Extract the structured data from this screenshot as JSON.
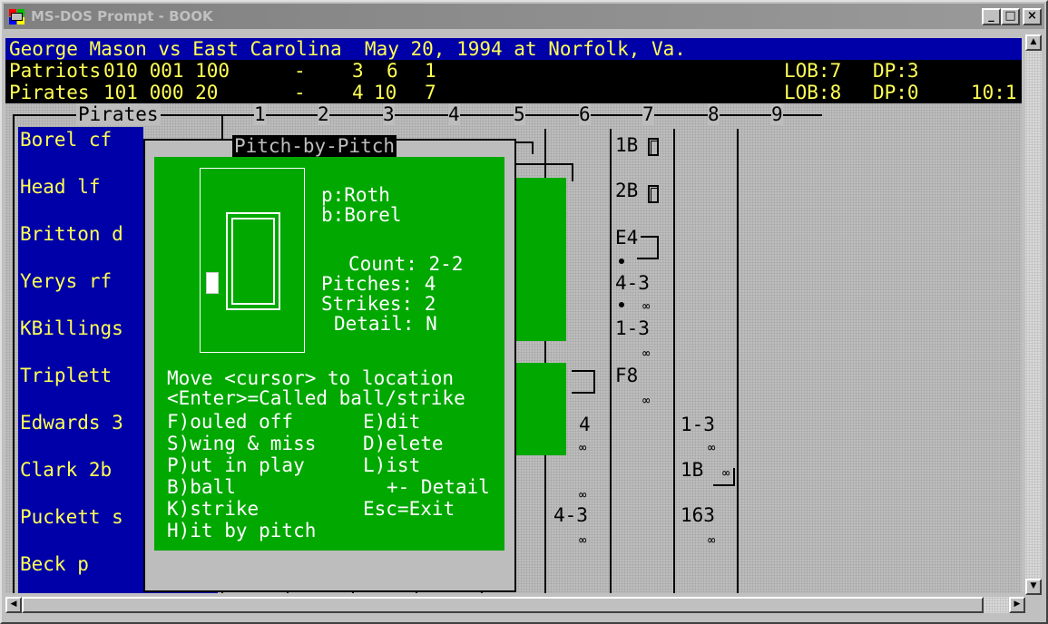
{
  "window": {
    "title": "MS-DOS Prompt - BOOK",
    "minimize_label": "_",
    "maximize_label": "□",
    "close_label": "×"
  },
  "header": {
    "game_line": "George Mason vs East Carolina  May 20, 1994 at Norfolk, Va.",
    "visitors": {
      "name": "Patriots",
      "innings": "010 001 100",
      "dash": "-",
      "runs": "3",
      "hits": "6",
      "errors": "1",
      "lob": "LOB:7",
      "dp": "DP:3"
    },
    "home": {
      "name": "Pirates",
      "innings": "101 000 20",
      "dash": "-",
      "runs": "4",
      "hits": "10",
      "errors": "7",
      "lob": "LOB:8",
      "dp": "DP:0",
      "time": "10:1"
    }
  },
  "scorecard": {
    "team_label": "Pirates",
    "innings": [
      "1",
      "2",
      "3",
      "4",
      "5",
      "6",
      "7",
      "8",
      "9"
    ],
    "players": [
      "Borel cf",
      "Head lf",
      "Britton d",
      "Yerys rf",
      "KBillings",
      "Triplett",
      "Edwards 3",
      "Clark 2b",
      "Puckett s",
      "Beck p"
    ],
    "inning7": [
      "1B",
      "2B",
      "E4",
      "4-3",
      "1-3",
      "F8"
    ],
    "inning6": [
      "4",
      "4-3"
    ],
    "inning8": [
      "1-3",
      "1B",
      "163"
    ],
    "marks": {
      "infinity": "∞"
    }
  },
  "popup": {
    "title": "Pitch-by-Pitch",
    "pitcher": "p:Roth",
    "batter": "b:Borel",
    "count": "Count: 2-2",
    "pitches": "Pitches: 4",
    "strikes": "Strikes: 2",
    "detail": "Detail: N",
    "instructions": [
      "Move <cursor> to location",
      "<Enter>=Called ball/strike"
    ],
    "commands_left": [
      "F)ouled off",
      "S)wing & miss",
      "P)ut in play",
      "B)ball",
      "K)strike",
      "H)it by pitch"
    ],
    "commands_right": [
      "E)dit",
      "D)elete",
      "L)ist",
      "+- Detail",
      "Esc=Exit"
    ]
  },
  "colors": {
    "console_blue": "#0000a8",
    "console_yellow": "#ffff55",
    "popup_green": "#00a800"
  }
}
